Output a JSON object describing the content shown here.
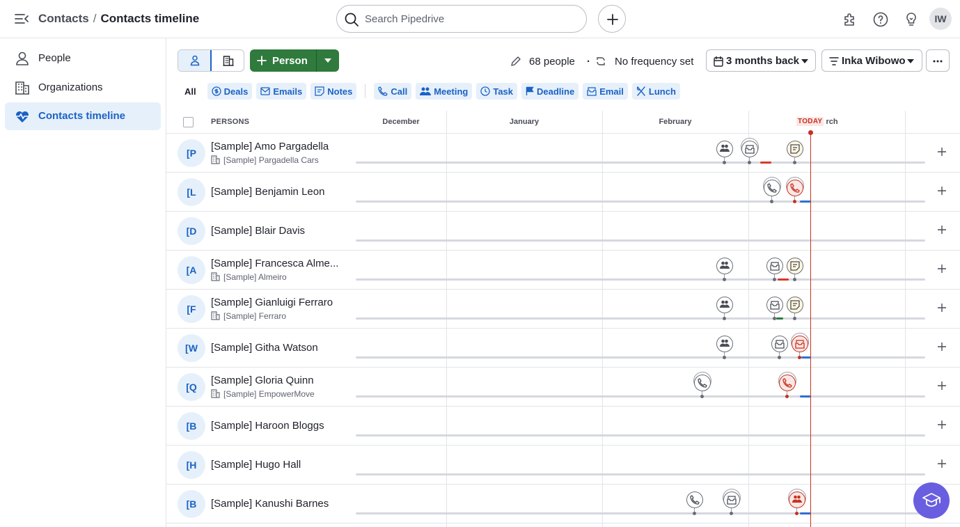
{
  "header": {
    "breadcrumb_parent": "Contacts",
    "breadcrumb_sep": "/",
    "breadcrumb_current": "Contacts timeline",
    "search_placeholder": "Search Pipedrive",
    "avatar_initials": "IW"
  },
  "sidebar": {
    "items": [
      {
        "label": "People",
        "icon": "person-icon"
      },
      {
        "label": "Organizations",
        "icon": "building-icon"
      },
      {
        "label": "Contacts timeline",
        "icon": "heart-pulse-icon",
        "active": true
      }
    ]
  },
  "toolbar": {
    "add_person_label": "Person",
    "people_count": "68 people",
    "dot": "·",
    "frequency": "No frequency set",
    "period": "3 months back",
    "owner_filter": "Inka Wibowo"
  },
  "filters": {
    "all": "All",
    "items": [
      "Deals",
      "Emails",
      "Notes",
      "Call",
      "Meeting",
      "Task",
      "Deadline",
      "Email",
      "Lunch"
    ]
  },
  "grid": {
    "persons_header": "PERSONS",
    "months": [
      "December",
      "January",
      "February",
      "rch"
    ],
    "today_label": "TODAY",
    "rows": [
      {
        "initials": "[P",
        "name": "[Sample] Amo Pargadella",
        "org": "[Sample] Pargadella Cars"
      },
      {
        "initials": "[L",
        "name": "[Sample] Benjamin Leon",
        "org": ""
      },
      {
        "initials": "[D",
        "name": "[Sample] Blair Davis",
        "org": ""
      },
      {
        "initials": "[A",
        "name": "[Sample] Francesca Alme...",
        "org": "[Sample] Almeiro"
      },
      {
        "initials": "[F",
        "name": "[Sample] Gianluigi Ferraro",
        "org": "[Sample] Ferraro"
      },
      {
        "initials": "[W",
        "name": "[Sample] Githa Watson",
        "org": ""
      },
      {
        "initials": "[Q",
        "name": "[Sample] Gloria Quinn",
        "org": "[Sample] EmpowerMove"
      },
      {
        "initials": "[B",
        "name": "[Sample] Haroon Bloggs",
        "org": ""
      },
      {
        "initials": "[H",
        "name": "[Sample] Hugo Hall",
        "org": ""
      },
      {
        "initials": "[B",
        "name": "[Sample] Kanushi Barnes",
        "org": ""
      }
    ]
  },
  "colors": {
    "accent": "#1b62c4",
    "accent_bg": "#e6f0fb",
    "primary_green": "#2f7a3c",
    "today_red": "#c8311f",
    "academy_purple": "#6a5ee0"
  }
}
